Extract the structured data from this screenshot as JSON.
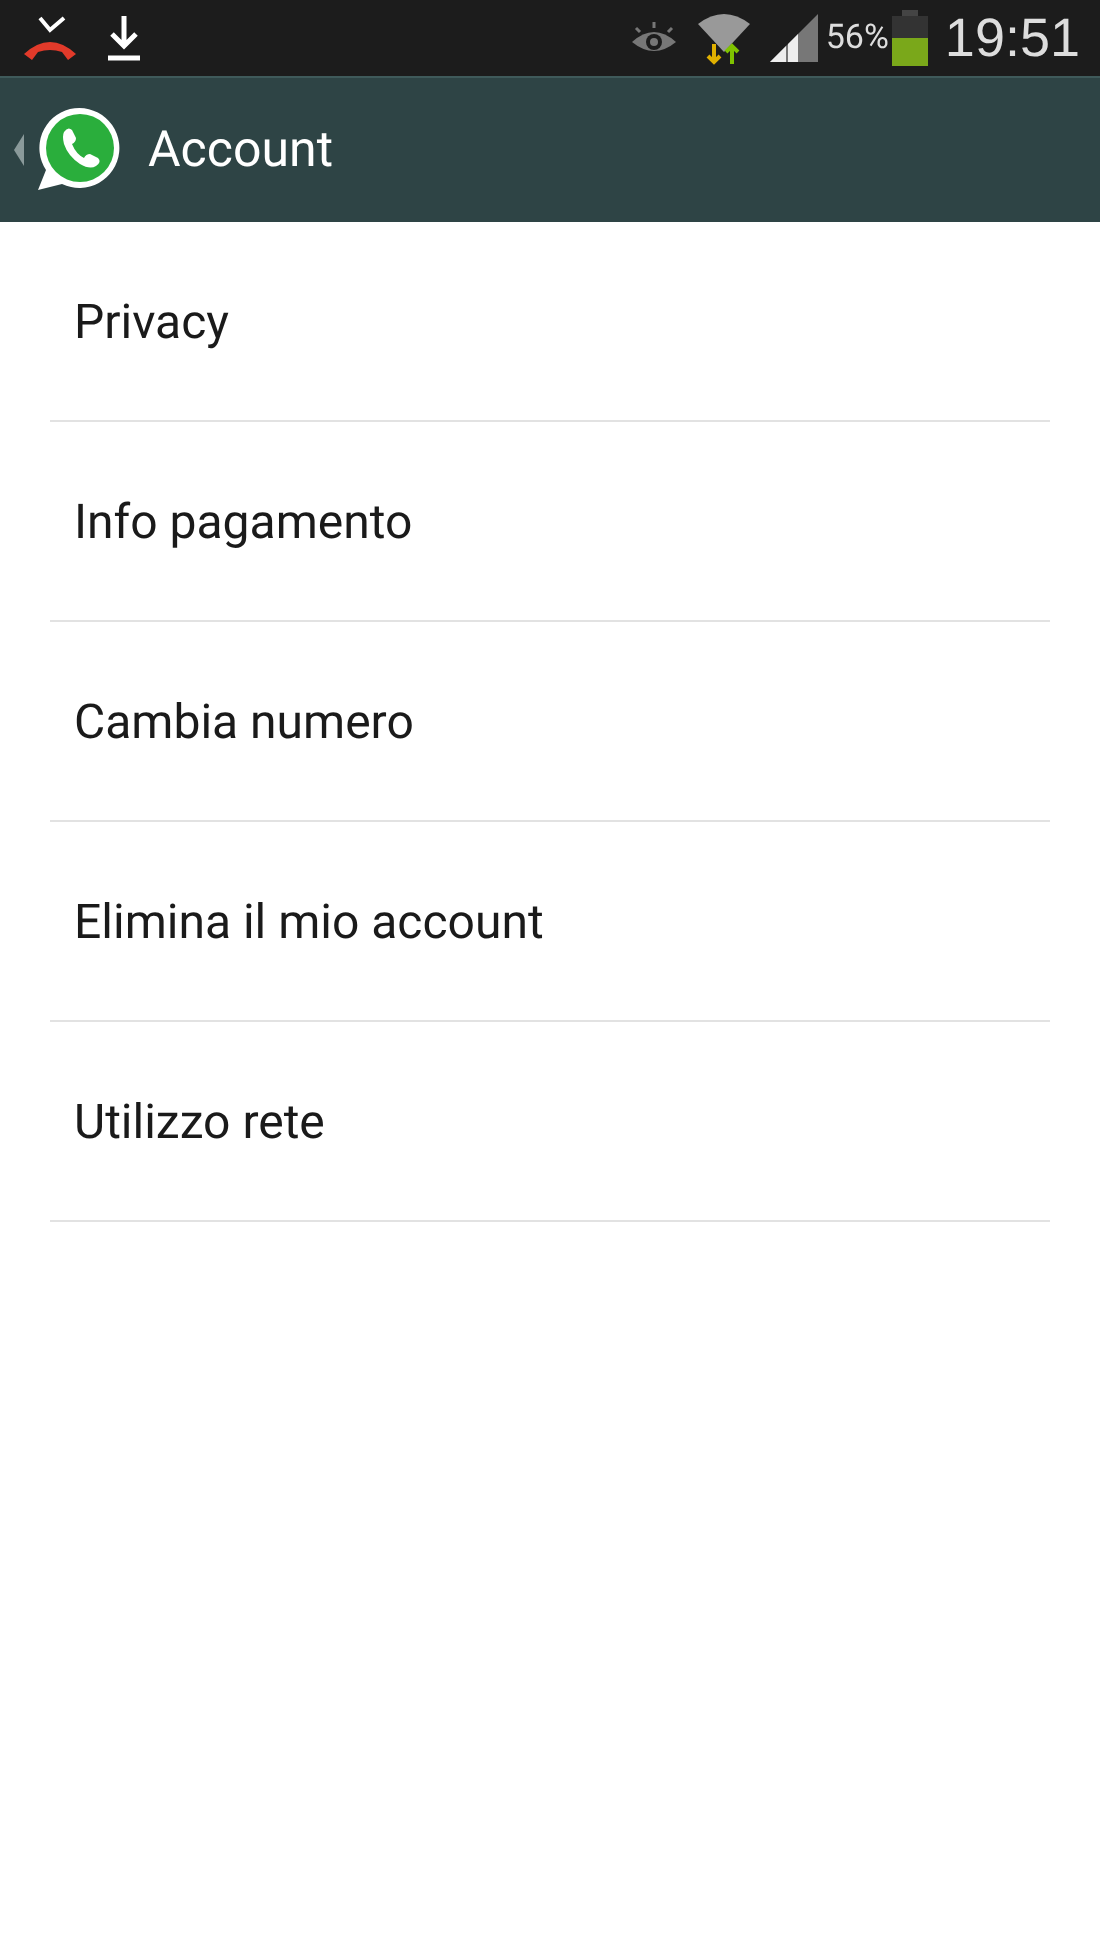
{
  "status_bar": {
    "battery_text": "56%",
    "time": "19:51"
  },
  "toolbar": {
    "title": "Account"
  },
  "items": [
    {
      "label": "Privacy"
    },
    {
      "label": "Info pagamento"
    },
    {
      "label": "Cambia numero"
    },
    {
      "label": "Elimina il mio account"
    },
    {
      "label": "Utilizzo rete"
    }
  ]
}
